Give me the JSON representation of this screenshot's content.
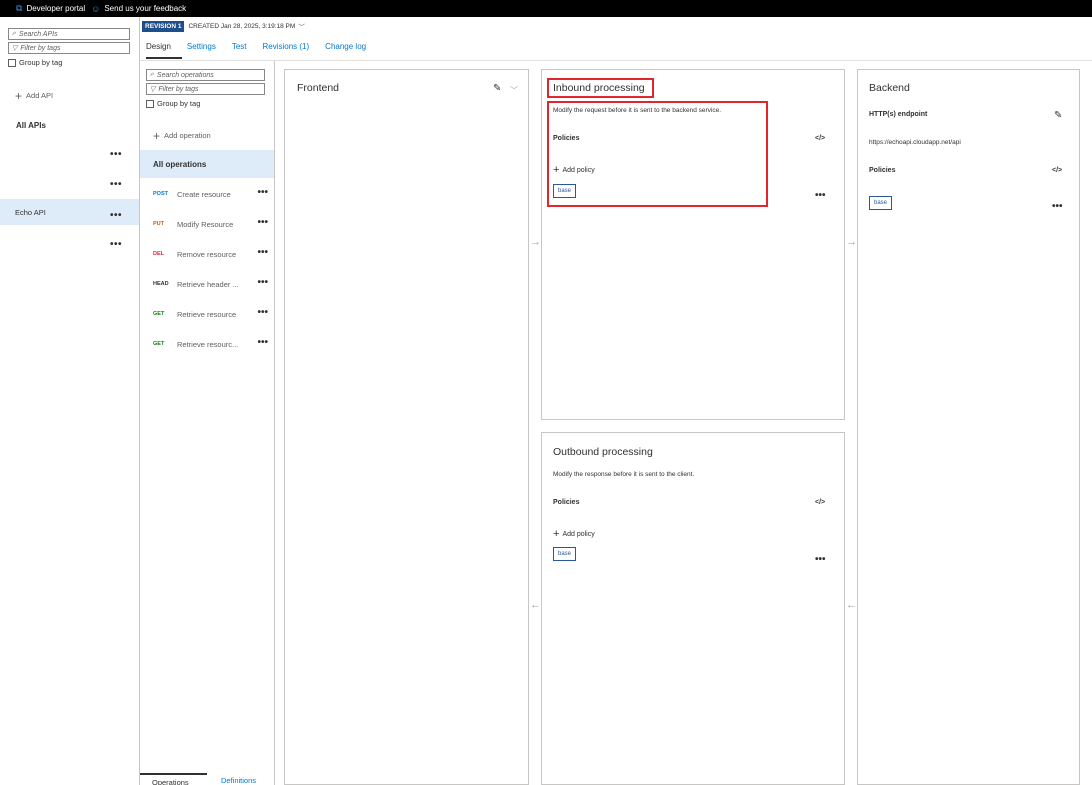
{
  "topbar": {
    "developer_portal": "Developer portal",
    "feedback": "Send us your feedback"
  },
  "api_pane": {
    "search_placeholder": "Search APIs",
    "filter_placeholder": "Filter by tags",
    "group_by_tag": "Group by tag",
    "add_api": "Add API",
    "all_apis": "All APIs",
    "selected_api": "Echo API"
  },
  "revision": {
    "badge": "REVISION 1",
    "created": "CREATED Jan 28, 2025, 3:19:18 PM"
  },
  "tabs": [
    {
      "label": "Design"
    },
    {
      "label": "Settings"
    },
    {
      "label": "Test"
    },
    {
      "label": "Revisions (1)"
    },
    {
      "label": "Change log"
    }
  ],
  "ops_pane": {
    "search_placeholder": "Search operations",
    "filter_placeholder": "Filter by tags",
    "group_by_tag": "Group by tag",
    "add_operation": "Add operation",
    "all_operations": "All operations",
    "operations": [
      {
        "method": "POST",
        "name": "Create resource",
        "color": "#0078d4"
      },
      {
        "method": "PUT",
        "name": "Modify Resource",
        "color": "#c55a11"
      },
      {
        "method": "DEL",
        "name": "Remove resource",
        "color": "#e3262e"
      },
      {
        "method": "HEAD",
        "name": "Retrieve header ...",
        "color": "#323130"
      },
      {
        "method": "GET",
        "name": "Retrieve resource",
        "color": "#107c10"
      },
      {
        "method": "GET",
        "name": "Retrieve resourc...",
        "color": "#107c10"
      }
    ],
    "footer_operations": "Operations",
    "footer_definitions": "Definitions"
  },
  "frontend": {
    "title": "Frontend"
  },
  "inbound": {
    "title": "Inbound processing",
    "description": "Modify the request before it is sent to the backend service.",
    "policies": "Policies",
    "code_icon": "</>",
    "add_policy": "Add policy",
    "base": "base"
  },
  "outbound": {
    "title": "Outbound processing",
    "description": "Modify the response before it is sent to the client.",
    "policies": "Policies",
    "code_icon": "</>",
    "add_policy": "Add policy",
    "base": "base"
  },
  "backend": {
    "title": "Backend",
    "endpoint_label": "HTTP(s) endpoint",
    "endpoint_url": "https://echoapi.cloudapp.net/api",
    "policies": "Policies",
    "code_icon": "</>",
    "base": "base"
  },
  "colors": {
    "highlight": "#e3262e",
    "accent": "#0078d4",
    "selected_bg": "#deecf9"
  }
}
